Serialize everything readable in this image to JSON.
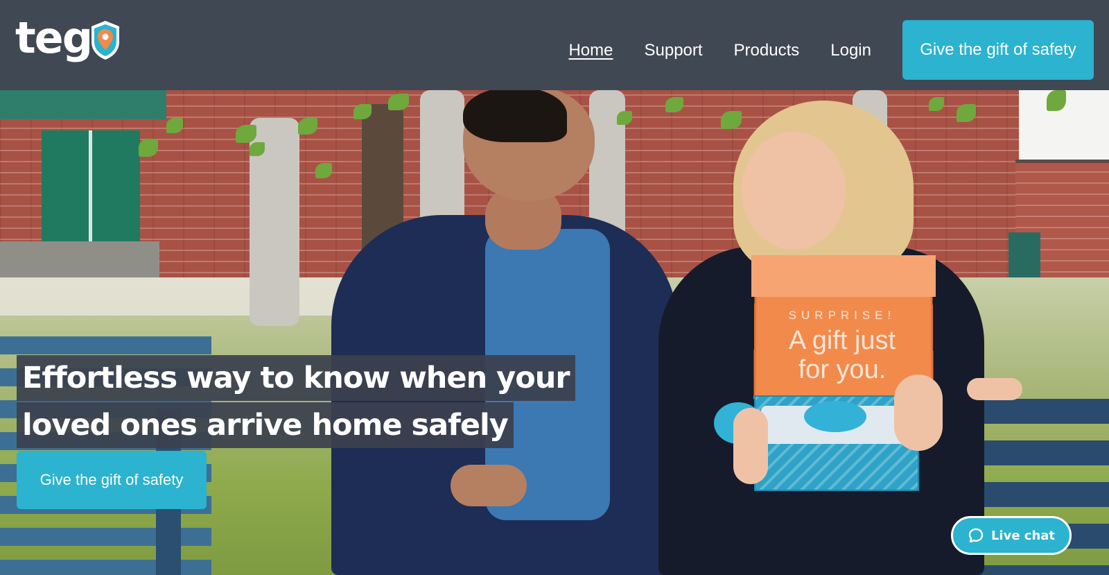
{
  "brand": {
    "logo_text": "teg",
    "colors": {
      "header_bg": "#404854",
      "accent": "#2bb3cf",
      "pin_orange": "#f28a4c",
      "pin_teal": "#2bb3cf"
    }
  },
  "nav": {
    "items": [
      {
        "label": "Home",
        "active": true
      },
      {
        "label": "Support",
        "active": false
      },
      {
        "label": "Products",
        "active": false
      },
      {
        "label": "Login",
        "active": false
      }
    ],
    "cta_label": "Give the gift of safety"
  },
  "hero": {
    "headline_line1": "Effortless way to know when your",
    "headline_line2": "loved ones arrive home safely",
    "cta_label": "Give the gift of safety",
    "box_text_small": "SURPRISE!",
    "box_text_large_1": "A gift just",
    "box_text_large_2": "for you."
  },
  "chat": {
    "label": "Live chat",
    "icon": "chat-bubble-icon"
  }
}
